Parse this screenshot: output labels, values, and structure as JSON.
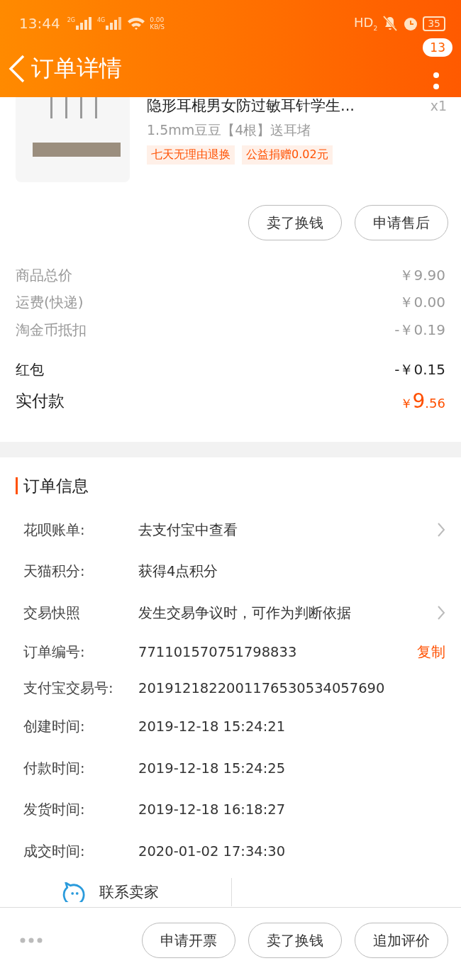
{
  "status_bar": {
    "time": "13:44",
    "sim_1": "2G",
    "sim_2": "4G",
    "speed_value": "0.00",
    "speed_unit": "KB/S",
    "hd": "HD",
    "hd_sub": "2",
    "battery": "35"
  },
  "header": {
    "title": "订单详情",
    "badge": "13"
  },
  "product": {
    "kind": "picture",
    "title": "隐形耳棍男女防过敏耳针学生...",
    "spec": "1.5mm豆豆【4根】送耳堵",
    "quantity": "x1",
    "tags": [
      "七天无理由退换",
      "公益捐赠0.02元"
    ],
    "actions": [
      "卖了换钱",
      "申请售后"
    ]
  },
  "price_summary": [
    {
      "kind": "muted",
      "label": "商品总价",
      "value": "￥9.90"
    },
    {
      "kind": "muted",
      "label": "运费(快递)",
      "value": "￥0.00"
    },
    {
      "kind": "muted",
      "label": "淘金币抵扣",
      "value": "-￥0.19"
    },
    {
      "kind": "normal",
      "label": "红包",
      "value": "-￥0.15"
    }
  ],
  "total": {
    "label": "实付款",
    "currency": "￥",
    "integer": "9",
    "decimal": ".56"
  },
  "order_info": {
    "title": "订单信息",
    "rows": [
      {
        "kind": "chevron",
        "label": "花呗账单:",
        "value": "去支付宝中查看"
      },
      {
        "kind": "plain",
        "label": "天猫积分:",
        "value": "获得4点积分"
      },
      {
        "kind": "chevron",
        "label": "交易快照",
        "value": "发生交易争议时，可作为判断依据"
      },
      {
        "kind": "copy",
        "label": "订单编号:",
        "value": "771101570751798833",
        "action": "复制"
      },
      {
        "kind": "plain",
        "label": "支付宝交易号:",
        "value": "2019121822001176530534057690"
      },
      {
        "kind": "plain",
        "label": "创建时间:",
        "value": "2019-12-18 15:24:21"
      },
      {
        "kind": "plain",
        "label": "付款时间:",
        "value": "2019-12-18 15:24:25"
      },
      {
        "kind": "plain",
        "label": "发货时间:",
        "value": "2019-12-18 16:18:27"
      },
      {
        "kind": "plain",
        "label": "成交时间:",
        "value": "2020-01-02 17:34:30"
      }
    ]
  },
  "contact": {
    "label": "联系卖家"
  },
  "footer": {
    "buttons": [
      "申请开票",
      "卖了换钱",
      "追加评价"
    ]
  }
}
